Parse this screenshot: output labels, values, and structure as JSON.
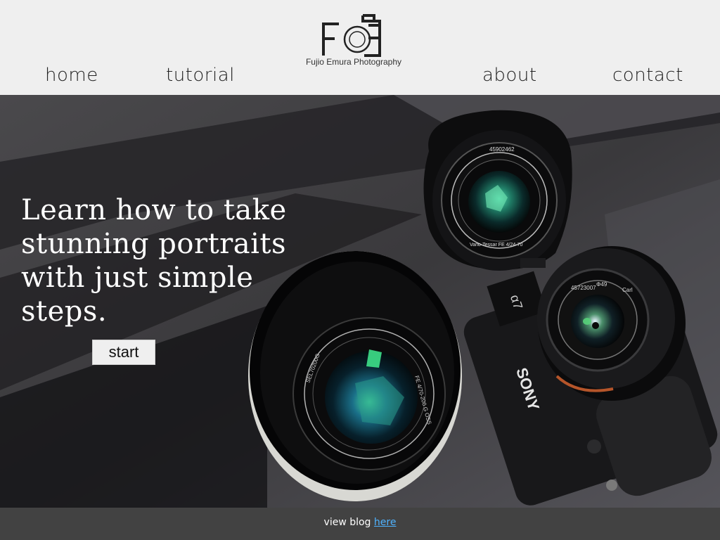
{
  "nav": {
    "home": "home",
    "tutorial": "tutorial",
    "about": "about",
    "contact": "contact"
  },
  "logo": {
    "caption": "Fujio Emura Photography",
    "icon": "camera-logo-icon"
  },
  "hero": {
    "heading": "Learn how to take stunning portraits with just simple steps.",
    "start_label": "start",
    "background": "camera-lenses-photo"
  },
  "footer": {
    "text": "view blog",
    "link_label": "here"
  },
  "colors": {
    "header_bg": "#efefef",
    "footer_bg": "#424242",
    "link": "#4fb3ff"
  }
}
